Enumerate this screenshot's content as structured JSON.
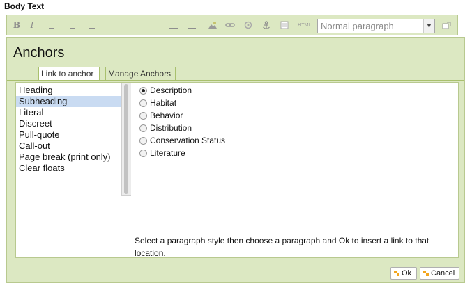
{
  "field": {
    "label": "Body Text"
  },
  "toolbar": {
    "bold_label": "B",
    "italic_label": "I",
    "html_label": "HTML",
    "paragraph_style": {
      "selected": "Normal paragraph"
    }
  },
  "dialog": {
    "title": "Anchors",
    "tabs": [
      {
        "label": "Link to anchor",
        "active": true
      },
      {
        "label": "Manage Anchors",
        "active": false
      }
    ],
    "styles": [
      "Heading",
      "Subheading",
      "Literal",
      "Discreet",
      "Pull-quote",
      "Call-out",
      "Page break (print only)",
      "Clear floats"
    ],
    "selected_style": "Subheading",
    "paragraphs": [
      {
        "label": "Description",
        "checked": true
      },
      {
        "label": "Habitat",
        "checked": false
      },
      {
        "label": "Behavior",
        "checked": false
      },
      {
        "label": "Distribution",
        "checked": false
      },
      {
        "label": "Conservation Status",
        "checked": false
      },
      {
        "label": "Literature",
        "checked": false
      }
    ],
    "hint": "Select a paragraph style then choose a paragraph and Ok to insert a link to that location.",
    "buttons": {
      "ok": "Ok",
      "cancel": "Cancel"
    }
  },
  "colors": {
    "toolbar_bg": "#dce8c2",
    "border": "#b8c98f",
    "selection": "#c9dbf2",
    "button_icon": "#f3a51e"
  },
  "icons": [
    "bold-icon",
    "italic-icon",
    "align-left-icon",
    "align-center-icon",
    "align-right-icon",
    "numbered-list-icon",
    "bulleted-list-icon",
    "indent-icon",
    "outdent-icon",
    "blockquote-icon",
    "image-icon",
    "link-icon",
    "unlink-icon",
    "anchor-icon",
    "table-icon",
    "html-icon",
    "popout-icon"
  ]
}
